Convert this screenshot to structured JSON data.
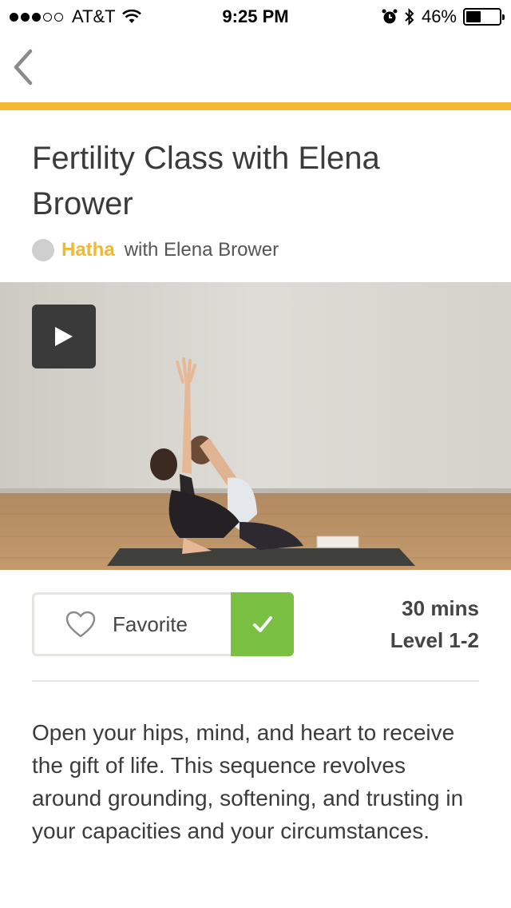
{
  "status_bar": {
    "signal_dots_full": 3,
    "signal_dots_total": 5,
    "carrier": "AT&T",
    "time": "9:25 PM",
    "battery": "46%",
    "battery_level": 0.46,
    "icons": [
      "wifi-icon",
      "alarm-icon",
      "bluetooth-icon",
      "battery-icon"
    ]
  },
  "nav": {
    "back_icon": "chevron-left-icon"
  },
  "colors": {
    "accent": "#f4b731",
    "check_green": "#7ac143",
    "play_bg": "#3a3a3a"
  },
  "class": {
    "title": "Fertility Class with Elena Brower",
    "style": "Hatha",
    "instructor": "with Elena Brower"
  },
  "video": {
    "play_icon": "play-icon"
  },
  "actions": {
    "favorite_label": "Favorite",
    "favorite_icon": "heart-outline-icon",
    "check_icon": "checkmark-icon"
  },
  "stats": {
    "duration": "30 mins",
    "level": "Level 1-2"
  },
  "description": "Open your hips, mind, and heart to receive the gift of life. This sequence revolves around grounding, softening, and trusting in your capacities and your circumstances."
}
